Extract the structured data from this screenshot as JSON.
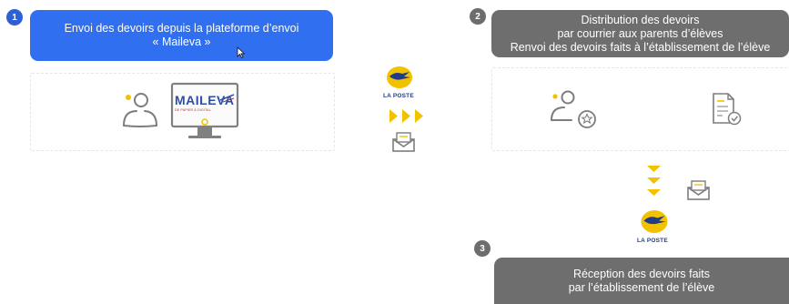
{
  "colors": {
    "accent_blue": "#2f6ff0",
    "step_blue": "#2f5fd6",
    "gray_banner": "#6e6e6e",
    "arrow_yellow": "#f2c200",
    "icon_gray": "#7d7d7d"
  },
  "step1": {
    "number": "1",
    "title_line1": "Envoi des devoirs depuis la plateforme d’envoi",
    "title_line2": "« Maileva »",
    "logo_text": "MAILEVA",
    "logo_subtext": "DE PAPIER À DIGITAL"
  },
  "step2": {
    "number": "2",
    "line1": "Distribution des devoirs",
    "line2": "par courrier aux parents d’élèves",
    "line3": "Renvoi des devoirs faits à l’établissement de l’élève"
  },
  "step3": {
    "number": "3",
    "line1": "Réception des devoirs faits",
    "line2": "par l’établissement de l’élève"
  },
  "laposte": {
    "label": "LA POSTE"
  },
  "icons": {
    "user": "user-icon",
    "monitor": "monitor-icon",
    "envelope": "envelope-icon",
    "user_badge": "user-star-icon",
    "document_check": "document-check-icon",
    "laposte_logo": "laposte-logo-icon",
    "cursor": "cursor-icon"
  }
}
